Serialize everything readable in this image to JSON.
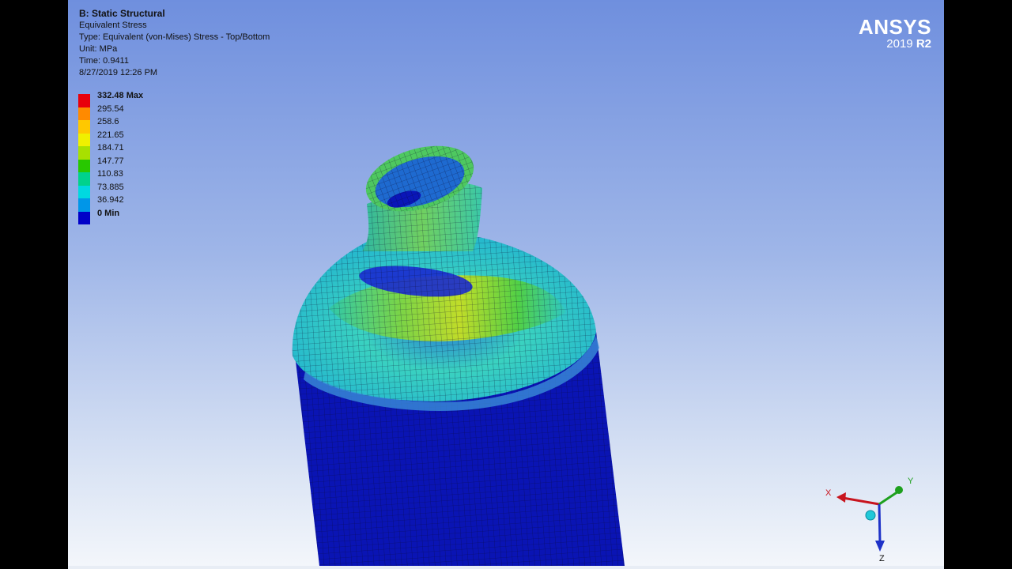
{
  "header": {
    "analysis": "B: Static Structural",
    "result": "Equivalent Stress",
    "type": "Type: Equivalent (von-Mises) Stress - Top/Bottom",
    "unit": "Unit: MPa",
    "time": "Time: 0.9411",
    "date": "8/27/2019 12:26 PM"
  },
  "legend": [
    {
      "label": "332.48 Max",
      "color": "#e8000b",
      "bold": true
    },
    {
      "label": "295.54",
      "color": "#ff8a00",
      "bold": false
    },
    {
      "label": "258.6",
      "color": "#ffc800",
      "bold": false
    },
    {
      "label": "221.65",
      "color": "#f0f000",
      "bold": false
    },
    {
      "label": "184.71",
      "color": "#a8e000",
      "bold": false
    },
    {
      "label": "147.77",
      "color": "#28c800",
      "bold": false
    },
    {
      "label": "110.83",
      "color": "#00d28c",
      "bold": false
    },
    {
      "label": "73.885",
      "color": "#00d8e0",
      "bold": false
    },
    {
      "label": "36.942",
      "color": "#0096e8",
      "bold": false
    },
    {
      "label": "0 Min",
      "color": "#0000c8",
      "bold": true
    }
  ],
  "brand": {
    "name": "ANSYS",
    "version_year": "2019",
    "version_release": "R2"
  },
  "triad": {
    "x_label": "X",
    "y_label": "Y",
    "z_label": "Z",
    "x_color": "#c8141e",
    "y_color": "#1ea01e",
    "z_color": "#1e32c8"
  }
}
